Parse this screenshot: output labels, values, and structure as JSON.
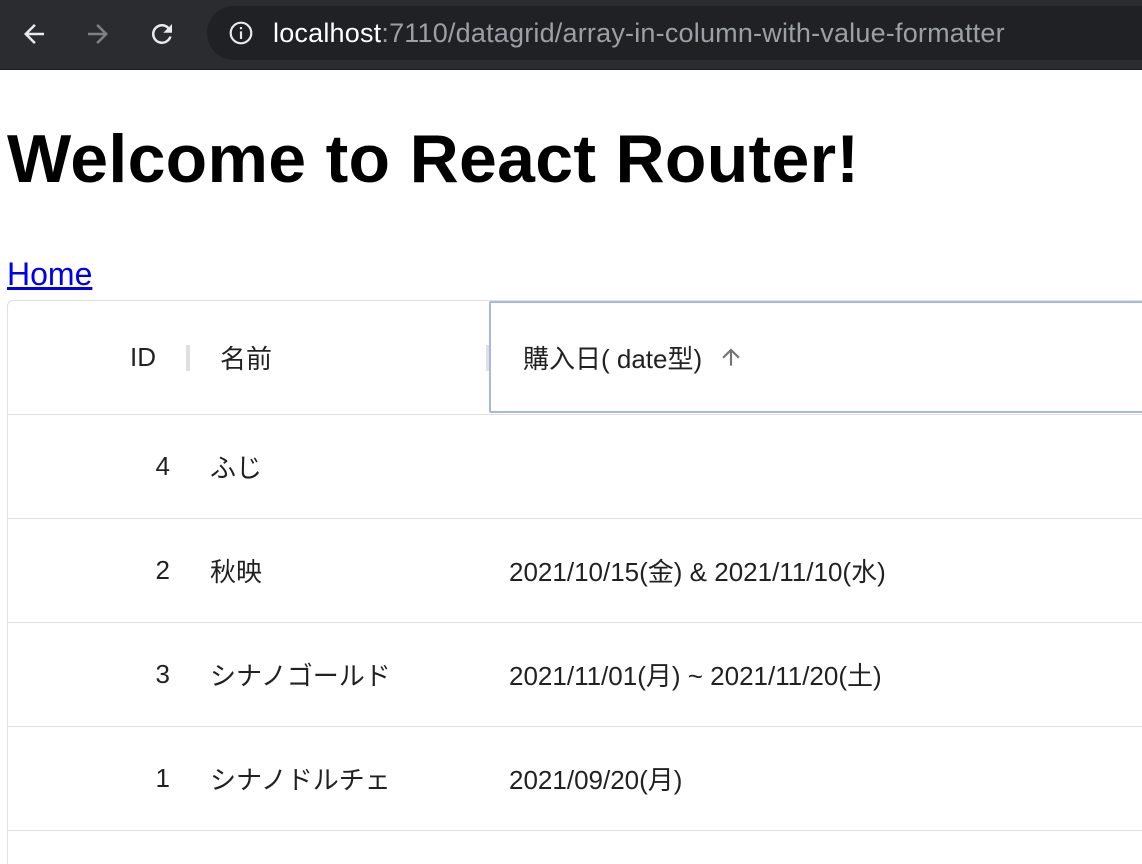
{
  "browser": {
    "url_host": "localhost",
    "url_path": ":7110/datagrid/array-in-column-with-value-formatter",
    "back_icon": "arrow-left-icon",
    "forward_icon": "arrow-right-icon",
    "reload_icon": "reload-icon",
    "info_icon": "info-icon"
  },
  "page": {
    "title": "Welcome to React Router!",
    "home_link": "Home"
  },
  "grid": {
    "columns": [
      {
        "label": "ID"
      },
      {
        "label": "名前"
      },
      {
        "label": "購入日( date型)",
        "sort": "ascending"
      }
    ],
    "rows": [
      {
        "id": "4",
        "name": "ふじ",
        "date": ""
      },
      {
        "id": "2",
        "name": "秋映",
        "date": "2021/10/15(金) & 2021/11/10(水)"
      },
      {
        "id": "3",
        "name": "シナノゴールド",
        "date": "2021/11/01(月) ~ 2021/11/20(土)"
      },
      {
        "id": "1",
        "name": "シナノドルチェ",
        "date": "2021/09/20(月)"
      }
    ]
  },
  "colors": {
    "chrome_bg": "#2b2c2f",
    "omnibox_bg": "#202124",
    "link": "#0000ee",
    "focus_outline": "#a5b8e8",
    "border": "#e0e0e0"
  }
}
